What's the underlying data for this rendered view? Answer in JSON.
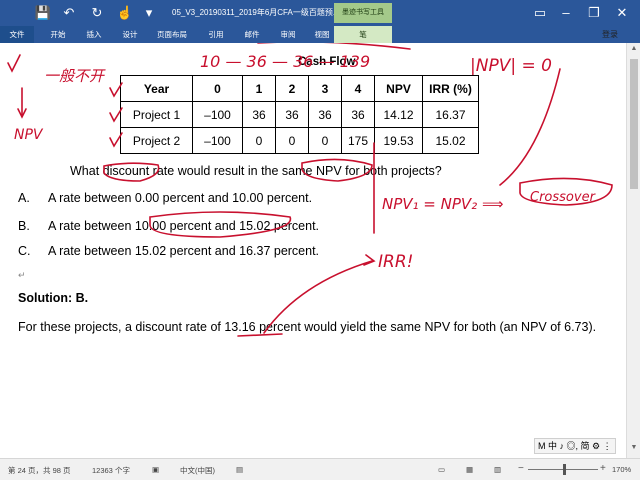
{
  "titlebar": {
    "doc_title": "05_V3_20190311_2019年6月CFA一级百题预...",
    "context_tab": "墨迹书写工具",
    "icons": [
      "save-icon",
      "undo-icon",
      "redo-icon",
      "touch-mode-icon",
      "customize-qat-icon"
    ],
    "window_controls": [
      "minimize-icon",
      "restore-icon",
      "close-icon"
    ]
  },
  "ribbon": {
    "tabs": [
      "文件",
      "开始",
      "插入",
      "设计",
      "页面布局",
      "引用",
      "邮件",
      "审阅",
      "视图",
      "笔"
    ],
    "signin": "登录"
  },
  "document": {
    "cashflow_title": "Cash Flow",
    "table": {
      "headers": [
        "Year",
        "0",
        "1",
        "2",
        "3",
        "4",
        "NPV",
        "IRR (%)"
      ],
      "rows": [
        [
          "Project 1",
          "–100",
          "36",
          "36",
          "36",
          "36",
          "14.12",
          "16.37"
        ],
        [
          "Project 2",
          "–100",
          "0",
          "0",
          "0",
          "175",
          "19.53",
          "15.02"
        ]
      ]
    },
    "question": "What discount rate would result in the same NPV for both projects?",
    "options": [
      {
        "letter": "A.",
        "text": "A rate between 0.00 percent and 10.00 percent."
      },
      {
        "letter": "B.",
        "text": "A rate between 10.00 percent and 15.02 percent."
      },
      {
        "letter": "C.",
        "text": "A rate between 15.02 percent and 16.37 percent."
      }
    ],
    "para_mark": "↵",
    "solution_label": "Solution: B.",
    "solution_text": "For these projects, a discount rate of 13.16 percent would yield the same NPV for both (an NPV of 6.73).",
    "annotations": {
      "top": "10 — 36 — 36 — 139",
      "npv_abs": "|NPV| = 0",
      "left_top": "一般不开",
      "left_npv": "NPV",
      "mid": "NPV₁ = NPV₂ ⟹",
      "crossover": "Crossover",
      "irr": "IRR!"
    },
    "ink_color": "#c8102e"
  },
  "floatbar": "M 中 ♪ ◎, 简 ⚙ ⋮",
  "statusbar": {
    "page": "第 24 页，共 98 页",
    "words": "12363 个字",
    "lang": "中文(中国)",
    "zoom": "170%"
  }
}
